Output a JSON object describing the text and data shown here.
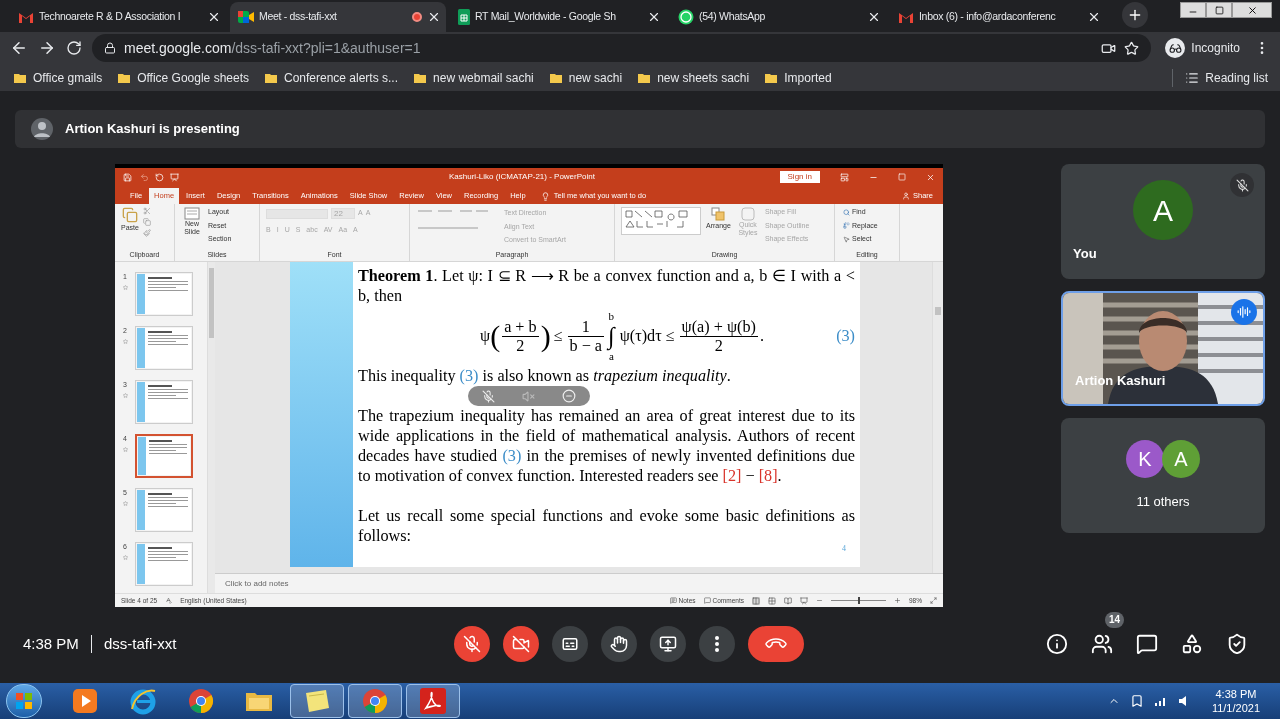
{
  "browser": {
    "tabs": [
      {
        "kind": "gmail",
        "title": "Technoarete R & D Association I",
        "selected": false,
        "recording": false
      },
      {
        "kind": "meet",
        "title": "Meet - dss-tafi-xxt",
        "selected": true,
        "recording": true
      },
      {
        "kind": "sheets",
        "title": "RT Mail_Worldwide - Google Sh",
        "selected": false,
        "recording": false
      },
      {
        "kind": "whatsapp",
        "title": "(54) WhatsApp",
        "selected": false,
        "recording": false
      },
      {
        "kind": "gmail",
        "title": "Inbox (6) - info@ardaconferenc",
        "selected": false,
        "recording": false
      }
    ],
    "address": {
      "host": "meet.google.com",
      "path": "/dss-tafi-xxt?pli=1&authuser=1"
    },
    "profile": "Incognito",
    "bookmarks": [
      "Office gmails",
      "Office Google sheets",
      "Conference alerts s...",
      "new webmail sachi",
      "new sachi",
      "new sheets sachi",
      "Imported"
    ],
    "reading_list": "Reading list"
  },
  "meet": {
    "banner": "Artion Kashuri is presenting",
    "powerpoint": {
      "title": "Kashuri-Liko (ICMATAP-21) - PowerPoint",
      "sign_in": "Sign in",
      "tabs": [
        {
          "label": "File",
          "selected": false
        },
        {
          "label": "Home",
          "selected": true
        },
        {
          "label": "Insert",
          "selected": false
        },
        {
          "label": "Design",
          "selected": false
        },
        {
          "label": "Transitions",
          "selected": false
        },
        {
          "label": "Animations",
          "selected": false
        },
        {
          "label": "Slide Show",
          "selected": false
        },
        {
          "label": "Review",
          "selected": false
        },
        {
          "label": "View",
          "selected": false
        },
        {
          "label": "Recording",
          "selected": false
        },
        {
          "label": "Help",
          "selected": false
        }
      ],
      "tell_me": "Tell me what you want to do",
      "share": "Share",
      "ribbon": {
        "clipboard": {
          "label": "Clipboard",
          "paste": "Paste"
        },
        "slides": {
          "label": "Slides",
          "new_slide": "New Slide",
          "layout": "Layout",
          "reset": "Reset",
          "section": "Section"
        },
        "font": {
          "label": "Font",
          "size": "22",
          "size_buttons": [
            "A",
            "A"
          ],
          "format_buttons": [
            "B",
            "I",
            "U",
            "S",
            "abc",
            "AV",
            "Aa",
            "A"
          ],
          "disabled": true
        },
        "paragraph": {
          "label": "Paragraph",
          "text_direction": "Text Direction",
          "align_text": "Align Text",
          "convert": "Convert to SmartArt",
          "disabled": true
        },
        "drawing": {
          "label": "Drawing",
          "arrange": "Arrange",
          "quick_styles": "Quick Styles",
          "shape_fill": "Shape Fill",
          "shape_outline": "Shape Outline",
          "shape_effects": "Shape Effects",
          "disabled": true
        },
        "editing": {
          "label": "Editing",
          "find": "Find",
          "replace": "Replace",
          "select": "Select"
        }
      },
      "thumbnails": [
        {
          "number": "1",
          "selected": false
        },
        {
          "number": "2",
          "selected": false
        },
        {
          "number": "3",
          "selected": false
        },
        {
          "number": "4",
          "selected": true
        },
        {
          "number": "5",
          "selected": false
        },
        {
          "number": "6",
          "selected": false
        }
      ],
      "slide": {
        "blocks": [
          {
            "kind": "line",
            "runs": [
              {
                "kind": "bold",
                "text": "Theorem 1"
              },
              {
                "kind": "plain",
                "text": ". Let ψ: I ⊆ R ⟶ R be a convex function and a, b ∈ I with a < b, then"
              }
            ]
          },
          {
            "kind": "formula",
            "open": "(",
            "close": ")",
            "func": "ψ",
            "num1": "a + b",
            "den1": "2",
            "le": "≤",
            "num2": "1",
            "den2": "b − a",
            "integral": "∫",
            "upper": "b",
            "lower": "a",
            "integrand": "ψ(τ)dτ ≤",
            "num3": "ψ(a) + ψ(b)",
            "den3": "2",
            "end": ".",
            "label": "(3)"
          },
          {
            "kind": "line",
            "runs": [
              {
                "kind": "plain",
                "text": "This inequality "
              },
              {
                "kind": "ref",
                "text": "(3)"
              },
              {
                "kind": "plain",
                "text": " is also known as "
              },
              {
                "kind": "italic",
                "text": "trapezium inequality"
              },
              {
                "kind": "plain",
                "text": "."
              }
            ]
          },
          {
            "kind": "paragraph",
            "runs": [
              {
                "kind": "plain",
                "text": "The trapezium inequality has remained an area of great interest due to its wide applications in the field of mathematical analysis. Authors of recent decades have studied "
              },
              {
                "kind": "ref",
                "text": "(3)"
              },
              {
                "kind": "plain",
                "text": " in the premises of newly invented definitions due to motivation of convex function. Interested readers see "
              },
              {
                "kind": "cite",
                "text": "[2]"
              },
              {
                "kind": "plain",
                "text": " − "
              },
              {
                "kind": "cite",
                "text": "[8]"
              },
              {
                "kind": "plain",
                "text": "."
              }
            ]
          },
          {
            "kind": "paragraph",
            "runs": [
              {
                "kind": "plain",
                "text": "Let us recall some special functions and evoke some basic definitions as follows:"
              }
            ]
          }
        ],
        "page_number": "4"
      },
      "notes_placeholder": "Click to add notes",
      "status": {
        "slide": "Slide 4 of 25",
        "language": "English (United States)",
        "notes": "Notes",
        "comments": "Comments",
        "zoom": "98%",
        "zoom_level": {
          "level": 0.5
        }
      }
    },
    "tiles": [
      {
        "kind": "avatar",
        "name": "You",
        "muted": true,
        "speaking": false,
        "avatars": [
          {
            "letter": "A",
            "color": "#2e6b1f"
          }
        ]
      },
      {
        "kind": "video",
        "name": "Artion Kashuri",
        "muted": false,
        "speaking": true
      },
      {
        "kind": "group",
        "name": "11 others",
        "muted": false,
        "speaking": false,
        "avatars": [
          {
            "letter": "K",
            "color": "#9b59c9"
          },
          {
            "letter": "A",
            "color": "#5f9f36"
          }
        ]
      }
    ],
    "time": "4:38 PM",
    "meeting_code": "dss-tafi-xxt",
    "controls": [
      {
        "kind": "mic",
        "on": false
      },
      {
        "kind": "camera",
        "on": false
      },
      {
        "kind": "captions",
        "on": false
      },
      {
        "kind": "hand",
        "on": false
      },
      {
        "kind": "present",
        "on": false
      },
      {
        "kind": "more"
      },
      {
        "kind": "leave"
      }
    ],
    "side_buttons": [
      {
        "kind": "info"
      },
      {
        "kind": "people",
        "badge": "14"
      },
      {
        "kind": "chat"
      },
      {
        "kind": "activities"
      },
      {
        "kind": "safety"
      }
    ]
  },
  "taskbar": {
    "apps": [
      {
        "kind": "media",
        "open": false
      },
      {
        "kind": "ie",
        "open": false
      },
      {
        "kind": "chrome",
        "open": false
      },
      {
        "kind": "folder",
        "open": false
      },
      {
        "kind": "notes",
        "open": true
      },
      {
        "kind": "chrome",
        "open": true
      },
      {
        "kind": "acrobat",
        "open": true
      }
    ],
    "time": "4:38 PM",
    "date": "11/1/2021"
  }
}
